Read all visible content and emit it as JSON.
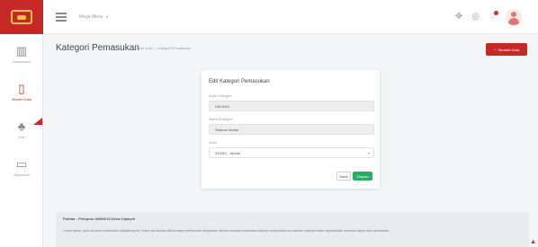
{
  "topbar": {
    "menu_label": "Mega Menu",
    "menu_caret": "∨",
    "icons": [
      "settings-icon",
      "info-icon",
      "notification-icon",
      "user-avatar-icon"
    ]
  },
  "sidebar": {
    "items": [
      {
        "label": "Dashboard",
        "icon": "chart-icon",
        "glyph": "▥"
      },
      {
        "label": "Master Data",
        "icon": "document-icon",
        "glyph": "▯"
      },
      {
        "label": "Kas",
        "icon": "money-icon",
        "glyph": "♣"
      },
      {
        "label": "Akuntansi",
        "icon": "book-icon",
        "glyph": "▭"
      }
    ],
    "active_index": 1,
    "accent": "#c62828"
  },
  "header": {
    "title": "Kategori Pemasukan",
    "breadcrumb": [
      "Master Data",
      "|",
      "Kategori Pemasukan"
    ],
    "add_button": "Tambah Data",
    "add_icon": "+"
  },
  "form": {
    "title": "Edit Kategori Pemasukan",
    "fields": [
      {
        "label": "Kode Kategori",
        "value": "KM-0001"
      },
      {
        "label": "Nama Kategori",
        "value": "Setoran Modal"
      },
      {
        "label": "Akun",
        "value": "310001 - Modal"
      }
    ],
    "select_caret": "▾",
    "back_button": "Batal",
    "save_button": "Simpan",
    "save_color": "#27ae60"
  },
  "footer": {
    "title": "Pokdar - Pemprov UMKM Di Desa Cipayeh",
    "text": "Lorem ipsum, dolor sit amet consectetur adipisicing elit. Libero aut dicutas officia saepe perferendis voluptatum minima numuam voluptates dolorum temporibus nisi maxime nostrum totam repudiandae commodi atque dolor quibusdam.",
    "corner_glyph": "▲"
  }
}
